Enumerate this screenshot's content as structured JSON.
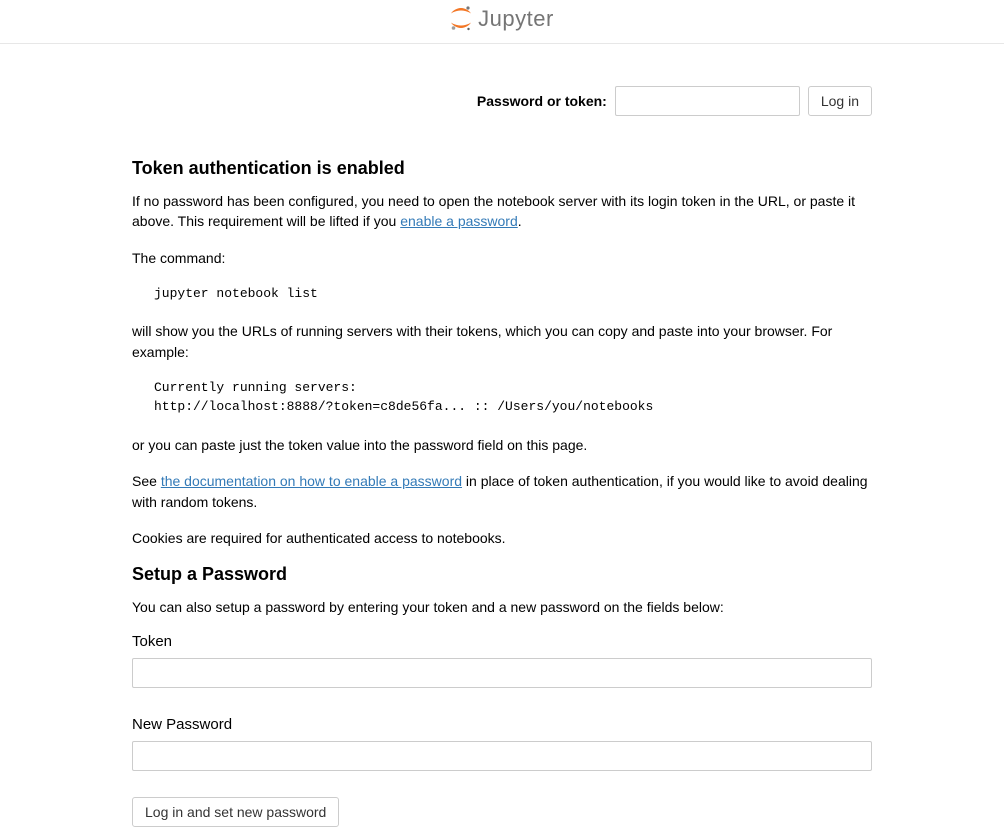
{
  "header": {
    "brand_text": "Jupyter"
  },
  "login": {
    "label": "Password or token:",
    "password_value": "",
    "login_button": "Log in"
  },
  "content": {
    "h_token_auth": "Token authentication is enabled",
    "p_no_password_pre": "If no password has been configured, you need to open the notebook server with its login token in the URL, or paste it above. This requirement will be lifted if you ",
    "link_enable_password": "enable a password",
    "p_no_password_post": ".",
    "p_command": "The command:",
    "code_command": "jupyter notebook list",
    "p_url_example": "will show you the URLs of running servers with their tokens, which you can copy and paste into your browser. For example:",
    "code_example": "Currently running servers:\nhttp://localhost:8888/?token=c8de56fa... :: /Users/you/notebooks",
    "p_paste_token": "or you can paste just the token value into the password field on this page.",
    "p_see_pre": "See ",
    "link_docs": "the documentation on how to enable a password",
    "p_see_post": " in place of token authentication, if you would like to avoid dealing with random tokens.",
    "p_cookies": "Cookies are required for authenticated access to notebooks.",
    "h_setup": "Setup a Password",
    "p_setup_desc": "You can also setup a password by entering your token and a new password on the fields below:",
    "label_token": "Token",
    "label_new_password": "New Password",
    "setup_button": "Log in and set new password"
  }
}
